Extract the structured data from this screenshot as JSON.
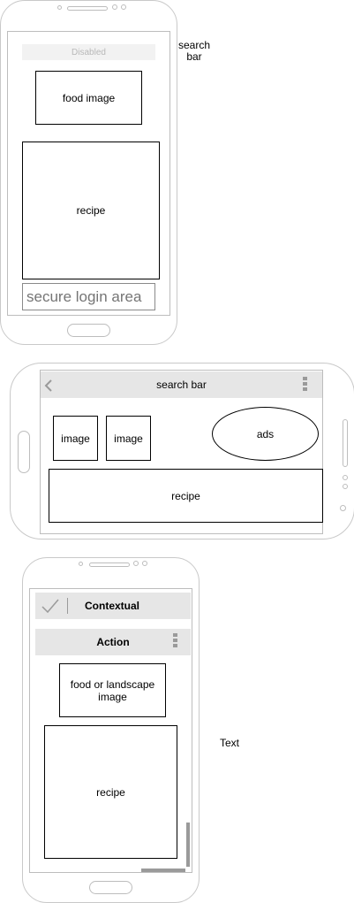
{
  "labels": {
    "search_bar_note": "search\nbar",
    "text_note": "Text"
  },
  "phone1": {
    "disabled_button": "Disabled",
    "food_image": "food image",
    "recipe": "recipe",
    "login_placeholder": "secure login area"
  },
  "phone2": {
    "search_bar_title": "search bar",
    "image_1": "image",
    "image_2": "image",
    "ads": "ads",
    "recipe": "recipe"
  },
  "phone3": {
    "contextual_title": "Contextual",
    "action_title": "Action",
    "food_landscape_image": "food or landscape image",
    "recipe": "recipe"
  },
  "colors": {
    "bar_bg": "#e6e6e6",
    "frame": "#c9c9c9",
    "icon_gray": "#9a9a9a"
  }
}
